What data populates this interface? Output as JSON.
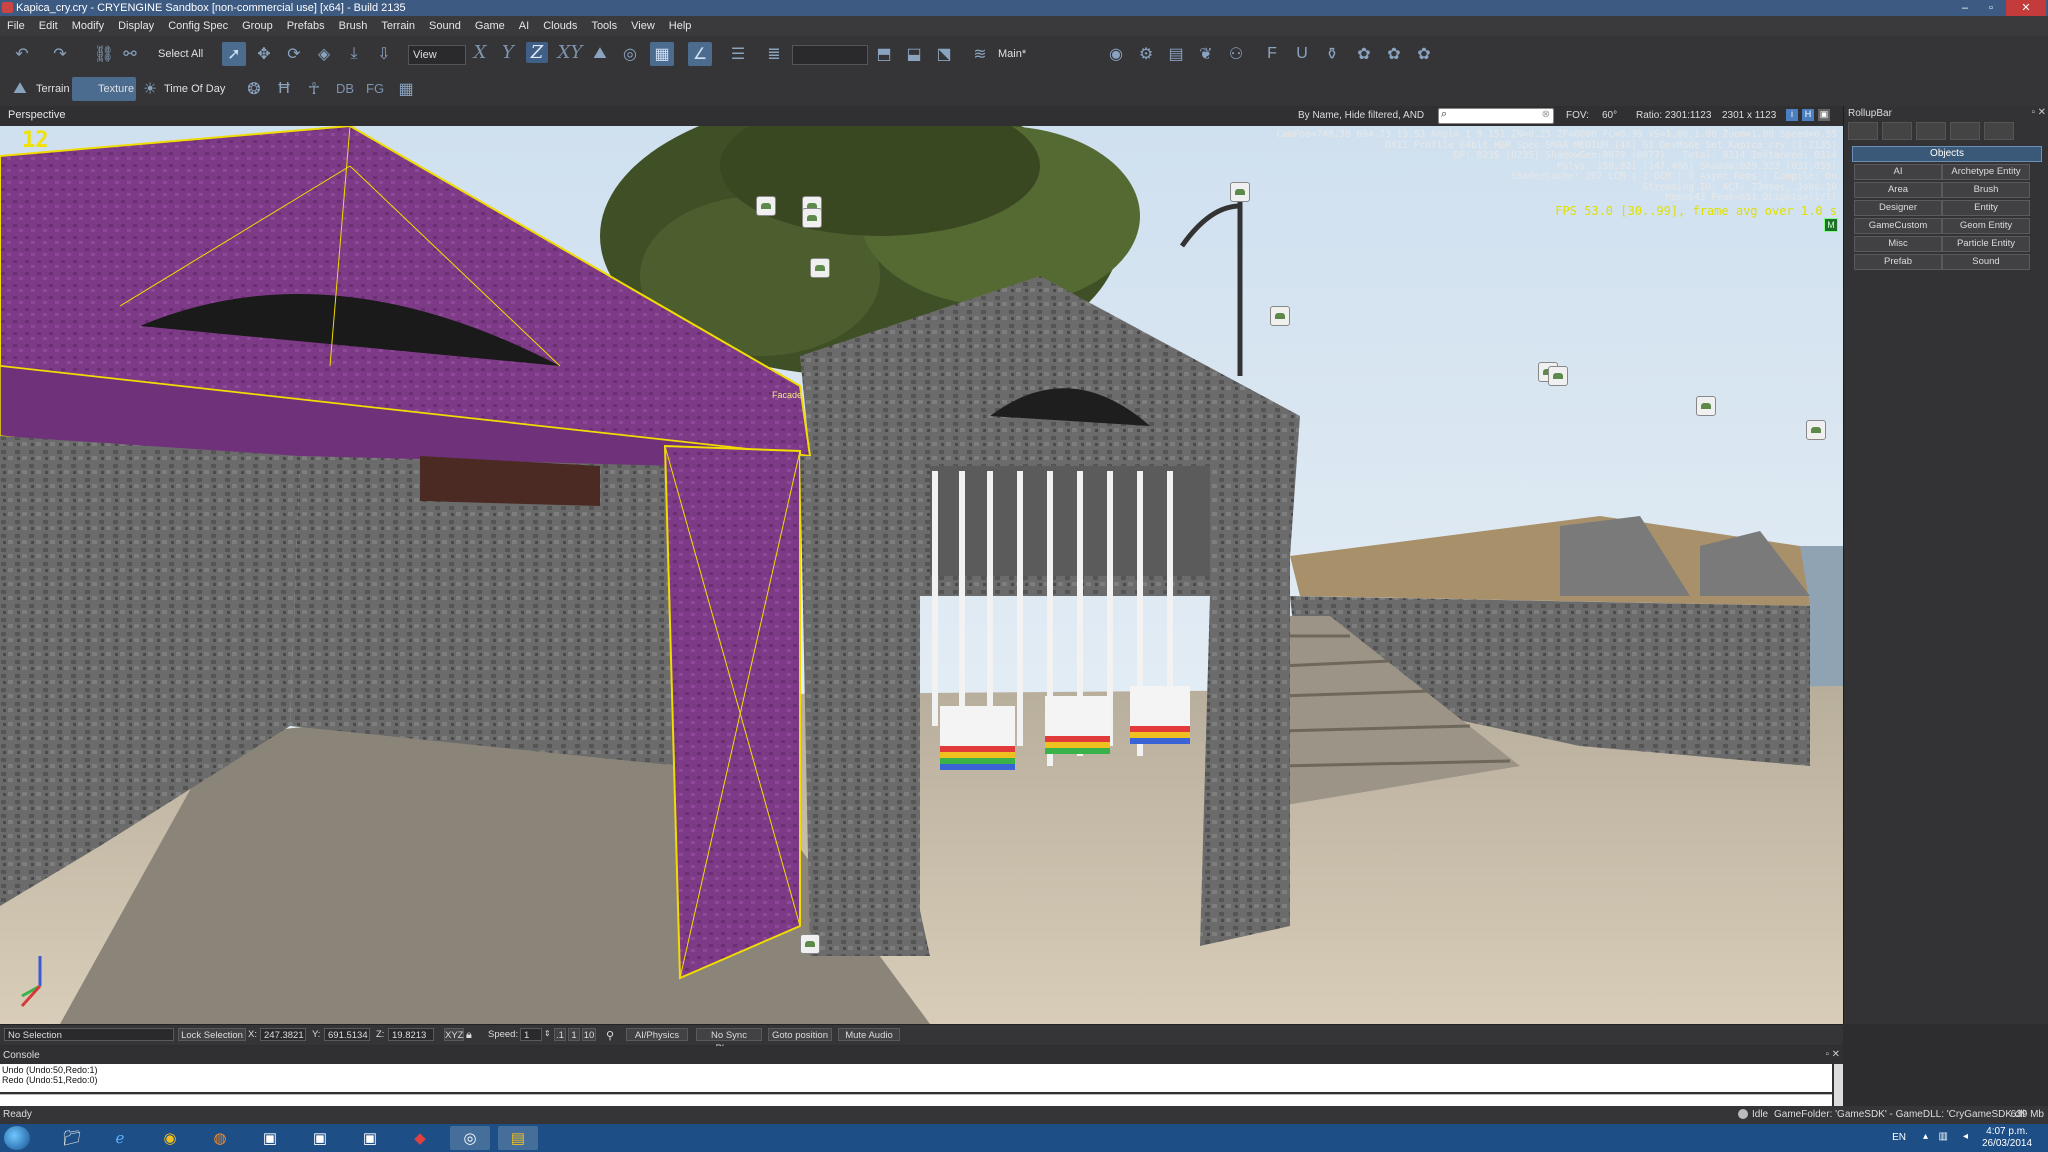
{
  "window": {
    "title": "Kapica_cry.cry - CRYENGINE Sandbox [non-commercial use] [x64] - Build 2135",
    "controls": [
      "–",
      "▫",
      "✕"
    ]
  },
  "menu": [
    "File",
    "Edit",
    "Modify",
    "Display",
    "Config Spec",
    "Group",
    "Prefabs",
    "Brush",
    "Terrain",
    "Sound",
    "Game",
    "AI",
    "Clouds",
    "Tools",
    "View",
    "Help"
  ],
  "toolbar1": {
    "select_label": "Select All",
    "view_label": "View",
    "axes": [
      "X",
      "Y",
      "Z",
      "XY"
    ],
    "layer_label": "Main*"
  },
  "toolbar2": {
    "terrain_label": "Terrain",
    "texture_label": "Texture",
    "time_of_day_label": "Time Of Day",
    "db_label": "DB",
    "fg_label": "FG"
  },
  "viewport": {
    "label": "Perspective",
    "filter_text": "By Name, Hide filtered, AND",
    "fov_label": "FOV:",
    "fov_value": "60°",
    "ratio_text": "Ratio: 2301:1123",
    "resolution_text": "2301 x 1123",
    "marker_number": "12",
    "facade_label": "Facade",
    "hud_lines": [
      "CamPos=748.38 694.73 13.53 Angl= 1  9.151 ZN=0.25 ZF=8000 FC=0.39 VS=1.00,1.00 Zoom=1.00 Speed=0.55",
      "DX11 Profile 64bit HDR Spec SMAA MEDIUM (4X) GI DevMode Set Kapica_cry (1.2135)",
      "DP: 0235 (0235) ShadowGen:0079 (0077) - Total: 0314 Instanced: 0314",
      "Polys: 150,921 (147,466) Shadow:029,323 (031,059)",
      "ShaderCache: 207 LCM | 2 GCM | 0 Async Reqs | Compile: On",
      "Streaming IO: ACT:  73msec, Jobs:10",
      "Mem=643 Peak=651 DLights=(1/1)"
    ],
    "fps_line": "FPS 53.0 [30..99], frame avg over 1.0 s"
  },
  "rollup": {
    "title": "RollupBar",
    "section_title": "Objects",
    "buttons": [
      "AI",
      "Archetype Entity",
      "Area",
      "Brush",
      "Designer",
      "Entity",
      "GameCustom",
      "Geom Entity",
      "Misc",
      "Particle Entity",
      "Prefab",
      "Sound"
    ]
  },
  "controls_bar": {
    "selection": "No Selection",
    "lock_selection": "Lock Selection",
    "x_label": "X:",
    "x_value": "247.3821",
    "y_label": "Y:",
    "y_value": "691.5134",
    "z_label": "Z:",
    "z_value": "19.8213",
    "xyz_label": "XYZ",
    "speed_label": "Speed:",
    "speed_value": "1",
    "speed_presets": [
      ".1",
      "1",
      "10"
    ],
    "ai_physics": "AI/Physics",
    "no_sync_player": "No Sync Player",
    "goto_position": "Goto position",
    "mute_audio": "Mute Audio"
  },
  "console": {
    "title": "Console",
    "lines": [
      "Undo (Undo:50,Redo:1)",
      "Redo (Undo:51,Redo:0)"
    ]
  },
  "status": {
    "ready": "Ready",
    "idle": "Idle",
    "game_folder": "GameFolder: 'GameSDK' - GameDLL: 'CryGameSDK.dll'",
    "memory": "639 Mb"
  },
  "taskbar": {
    "language": "EN",
    "time": "4:07 p.m.",
    "date": "26/03/2014"
  },
  "colors": {
    "accent": "#4b6b8f",
    "selection_outline": "#f0dc00",
    "hud_fps": "#e0e000",
    "taskbar": "#1d4f86"
  }
}
